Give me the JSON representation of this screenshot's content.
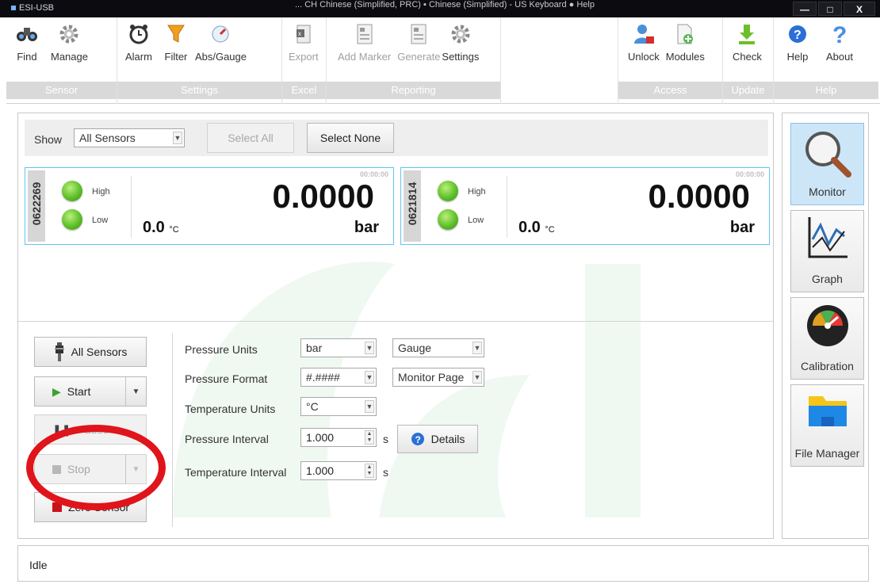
{
  "window": {
    "title": "ESI-USB",
    "lang_bar": "... CH Chinese (Simplified, PRC)  ▪ Chinese (Simplified) - US Keyboard  ● Help",
    "min": "—",
    "max": "□",
    "close": "X"
  },
  "ribbon": {
    "groups": [
      {
        "title": "Sensor",
        "buttons": [
          {
            "label": "Find",
            "icon": "binoculars-icon"
          },
          {
            "label": "Manage",
            "icon": "gear-icon"
          }
        ]
      },
      {
        "title": "Settings",
        "buttons": [
          {
            "label": "Alarm",
            "icon": "alarm-clock-icon"
          },
          {
            "label": "Filter",
            "icon": "funnel-icon"
          },
          {
            "label": "Abs/Gauge",
            "icon": "gauge-icon"
          }
        ]
      },
      {
        "title": "Excel",
        "buttons": [
          {
            "label": "Export",
            "icon": "excel-icon"
          }
        ]
      },
      {
        "title": "Reporting",
        "buttons": [
          {
            "label": "Add Marker",
            "icon": "report-icon"
          },
          {
            "label": "Generate",
            "icon": "report-icon"
          },
          {
            "label": "Settings",
            "icon": "gear-icon"
          }
        ]
      },
      {
        "title": "Access",
        "buttons": [
          {
            "label": "Unlock",
            "icon": "user-lock-icon"
          },
          {
            "label": "Modules",
            "icon": "add-document-icon"
          }
        ]
      },
      {
        "title": "Update",
        "buttons": [
          {
            "label": "Check",
            "icon": "download-icon"
          }
        ]
      },
      {
        "title": "Help",
        "buttons": [
          {
            "label": "Help",
            "icon": "help-icon"
          },
          {
            "label": "About",
            "icon": "question-icon"
          }
        ]
      }
    ]
  },
  "monitor": {
    "show_label": "Show",
    "show_value": "All Sensors",
    "select_all": "Select All",
    "select_none": "Select None",
    "sensors": [
      {
        "serial": "0622269",
        "high": "High",
        "low": "Low",
        "time": "00:00:00",
        "pressure": "0.0000",
        "unit": "bar",
        "temp": "0.0",
        "temp_unit": "°C"
      },
      {
        "serial": "0621814",
        "high": "High",
        "low": "Low",
        "time": "00:00:00",
        "pressure": "0.0000",
        "unit": "bar",
        "temp": "0.0",
        "temp_unit": "°C"
      }
    ]
  },
  "controls": {
    "all_sensors": "All Sensors",
    "start": "Start",
    "pause": "Pause",
    "stop": "Stop",
    "zero_sensor": "Zero Sensor"
  },
  "settings": {
    "pressure_units_label": "Pressure Units",
    "pressure_units_value": "bar",
    "gauge_value": "Gauge",
    "pressure_format_label": "Pressure Format",
    "pressure_format_value": "#.####",
    "format_target_value": "Monitor Page",
    "temperature_units_label": "Temperature Units",
    "temperature_units_value": "°C",
    "pressure_interval_label": "Pressure Interval",
    "pressure_interval_value": "1.000",
    "pressure_interval_unit": "s",
    "details": "Details",
    "temperature_interval_label": "Temperature Interval",
    "temperature_interval_value": "1.000",
    "temperature_interval_unit": "s"
  },
  "nav": {
    "monitor": "Monitor",
    "graph": "Graph",
    "calibration": "Calibration",
    "file_manager": "File Manager"
  },
  "status": {
    "text": "Idle"
  },
  "colors": {
    "card_border": "#5fc7ee",
    "lamp": "#5fbf2a",
    "annotation": "#e0141b",
    "zero_square": "#c8121b"
  }
}
